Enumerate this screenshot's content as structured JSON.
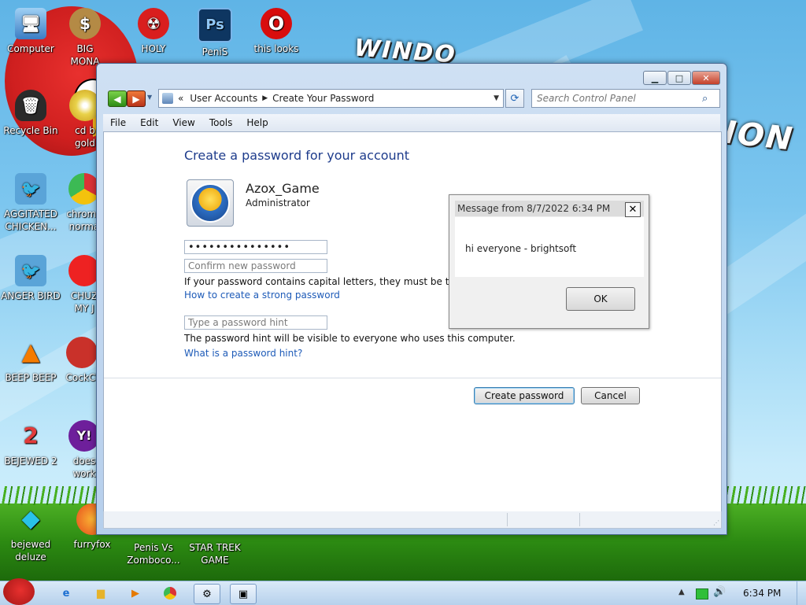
{
  "desktop": {
    "icons": [
      {
        "label": "Computer"
      },
      {
        "label": "BIG MONA"
      },
      {
        "label": "HOLY"
      },
      {
        "label": "PeniS"
      },
      {
        "label": "this looks"
      },
      {
        "label": "Recycle Bin"
      },
      {
        "label": "cd b gold"
      },
      {
        "label": "AGGITATED CHICKEN..."
      },
      {
        "label": "chrome norma"
      },
      {
        "label": "ANGER BIRD"
      },
      {
        "label": "CHUZ MY J"
      },
      {
        "label": "BEEP BEEP"
      },
      {
        "label": "CockCl"
      },
      {
        "label": "BEJEWED 2"
      },
      {
        "label": "does work"
      },
      {
        "label": "bejewed deluze"
      },
      {
        "label": "furryfox"
      },
      {
        "label": "Penis Vs Zomboco..."
      },
      {
        "label": "STAR TREK GAME"
      }
    ]
  },
  "window": {
    "breadcrumb_prefix": "«",
    "breadcrumb": [
      "User Accounts",
      "Create Your Password"
    ],
    "search_placeholder": "Search Control Panel",
    "menu": [
      "File",
      "Edit",
      "View",
      "Tools",
      "Help"
    ],
    "heading": "Create a password for your account",
    "account": {
      "name": "Azox_Game",
      "role": "Administrator"
    },
    "new_password_value": "•••••••••••••••",
    "confirm_placeholder": "Confirm new password",
    "caps_note": "If your password contains capital letters, they must be typ",
    "strong_password_link": "How to create a strong password",
    "hint_placeholder": "Type a password hint",
    "hint_note": "The password hint will be visible to everyone who uses this computer.",
    "hint_link": "What is a password hint?",
    "create_button": "Create password",
    "cancel_button": "Cancel"
  },
  "message_box": {
    "title": "Message from  8/7/2022 6:34 PM",
    "body": "hi everyone - brightsoft",
    "ok": "OK"
  },
  "taskbar": {
    "clock": "6:34 PM"
  }
}
